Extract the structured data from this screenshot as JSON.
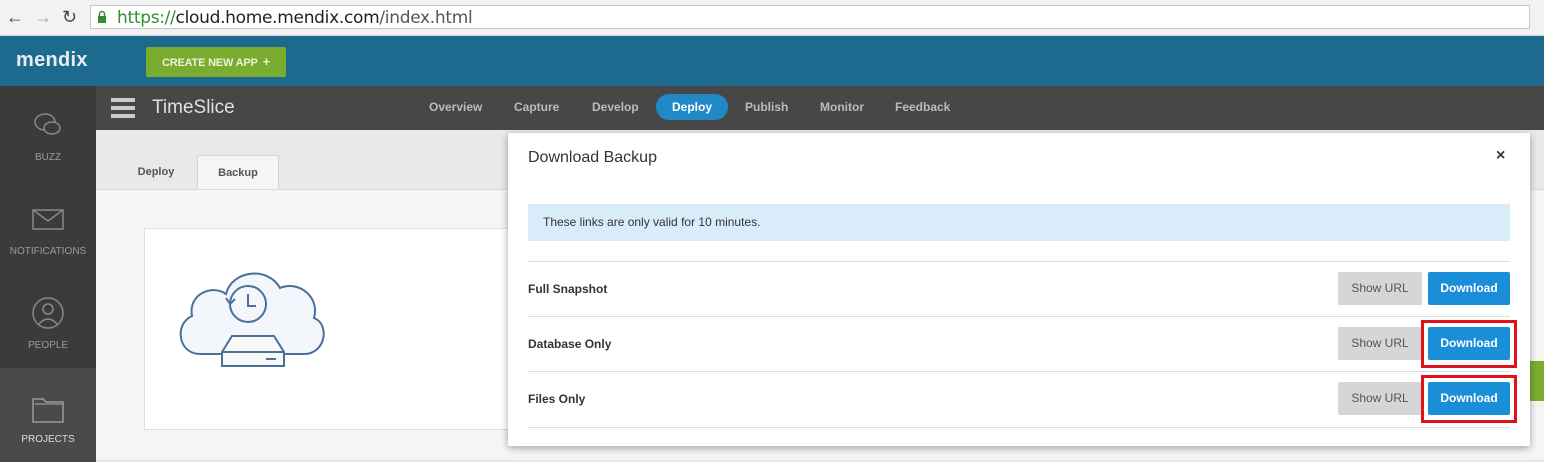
{
  "browser": {
    "url_scheme": "https://",
    "url_host": "cloud.home.mendix.com",
    "url_path": "/index.html"
  },
  "topbar": {
    "logo": "mendix",
    "create_label": "CREATE NEW APP",
    "create_icon": "+"
  },
  "rail": {
    "items": [
      {
        "label": "BUZZ",
        "icon": "chat-icon"
      },
      {
        "label": "NOTIFICATIONS",
        "icon": "envelope-icon"
      },
      {
        "label": "PEOPLE",
        "icon": "person-icon"
      },
      {
        "label": "PROJECTS",
        "icon": "folder-icon"
      }
    ]
  },
  "app": {
    "name": "TimeSlice",
    "tabs": [
      "Overview",
      "Capture",
      "Develop",
      "Deploy",
      "Publish",
      "Monitor",
      "Feedback"
    ],
    "active_tab": "Deploy"
  },
  "subtabs": {
    "items": [
      "Deploy",
      "Backup"
    ],
    "active": "Backup"
  },
  "modal": {
    "title": "Download Backup",
    "close": "×",
    "info": "These links are only valid for 10 minutes.",
    "rows": [
      {
        "label": "Full Snapshot",
        "show_url": "Show URL",
        "download": "Download"
      },
      {
        "label": "Database Only",
        "show_url": "Show URL",
        "download": "Download"
      },
      {
        "label": "Files Only",
        "show_url": "Show URL",
        "download": "Download"
      }
    ]
  },
  "colors": {
    "topbar": "#1d6a8e",
    "accent": "#1a8ed8",
    "create": "#7aad2f",
    "highlight": "#e2101d"
  }
}
